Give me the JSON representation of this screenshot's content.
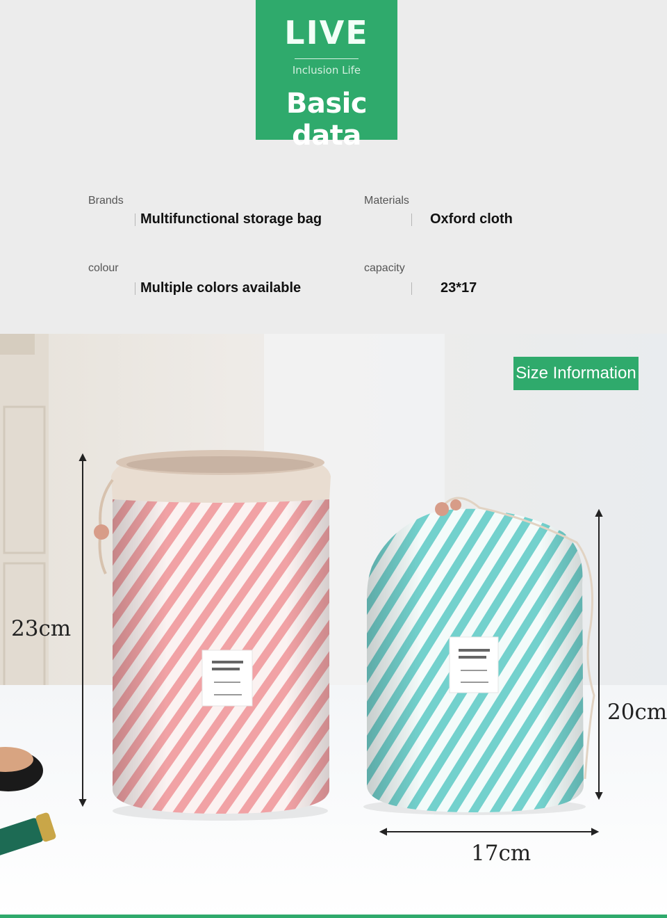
{
  "badge": {
    "live": "LIVE",
    "sub": "Inclusion Life",
    "title": "Basic data"
  },
  "info": {
    "brands_label": "Brands",
    "brands_value": "Multifunctional storage bag",
    "materials_label": "Materials",
    "materials_value": "Oxford cloth",
    "colour_label": "colour",
    "colour_value": "Multiple colors available",
    "capacity_label": "capacity",
    "capacity_value": "23*17"
  },
  "size_info": "Size Information",
  "dims": {
    "tall": "23cm",
    "short": "20cm",
    "width": "17cm"
  },
  "colors": {
    "accent": "#2faa6c",
    "pink_stripe": "#f1a2a5",
    "teal_stripe": "#73d1cd"
  }
}
